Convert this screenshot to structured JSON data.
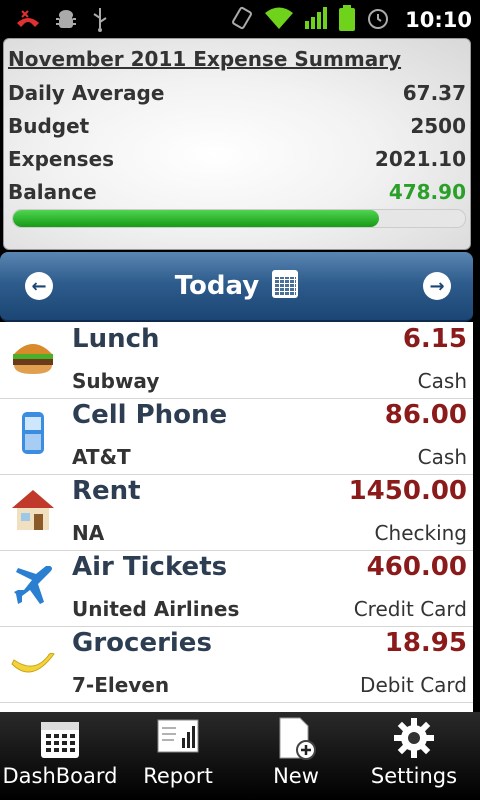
{
  "status_bar": {
    "time": "10:10",
    "icons": [
      "missed-call-icon",
      "android-debug-icon",
      "usb-icon",
      "vibrate-icon",
      "wifi-icon",
      "signal-icon",
      "battery-icon",
      "alarm-icon"
    ]
  },
  "summary": {
    "title": "November 2011 Expense Summary",
    "rows": [
      {
        "label": "Daily Average",
        "value": "67.37"
      },
      {
        "label": "Budget",
        "value": "2500"
      },
      {
        "label": "Expenses",
        "value": "2021.10"
      },
      {
        "label": "Balance",
        "value": "478.90"
      }
    ],
    "budget_used_fraction": 0.81,
    "colors": {
      "balance": "#2aa02a",
      "progress": "#22aa22"
    }
  },
  "nav": {
    "title": "Today",
    "prev_icon": "arrow-left-icon",
    "next_icon": "arrow-right-icon",
    "calendar_icon": "calendar-icon"
  },
  "expenses": [
    {
      "icon": "burger-icon",
      "name": "Lunch",
      "amount": "6.15",
      "payee": "Subway",
      "method": "Cash"
    },
    {
      "icon": "cell-phone-icon",
      "name": "Cell Phone",
      "amount": "86.00",
      "payee": "AT&T",
      "method": "Cash"
    },
    {
      "icon": "house-icon",
      "name": "Rent",
      "amount": "1450.00",
      "payee": "NA",
      "method": "Checking"
    },
    {
      "icon": "airplane-icon",
      "name": "Air Tickets",
      "amount": "460.00",
      "payee": "United Airlines",
      "method": "Credit Card"
    },
    {
      "icon": "banana-icon",
      "name": "Groceries",
      "amount": "18.95",
      "payee": "7-Eleven",
      "method": "Debit Card"
    }
  ],
  "bottom_nav": [
    {
      "label": "DashBoard",
      "icon": "calendar-grid-icon"
    },
    {
      "label": "Report",
      "icon": "report-chart-icon"
    },
    {
      "label": "New",
      "icon": "new-document-icon"
    },
    {
      "label": "Settings",
      "icon": "gear-icon"
    }
  ],
  "colors": {
    "amount": "#8b1a1a",
    "item_name": "#2d3d52",
    "nav_bar": "#2e5c8c"
  }
}
